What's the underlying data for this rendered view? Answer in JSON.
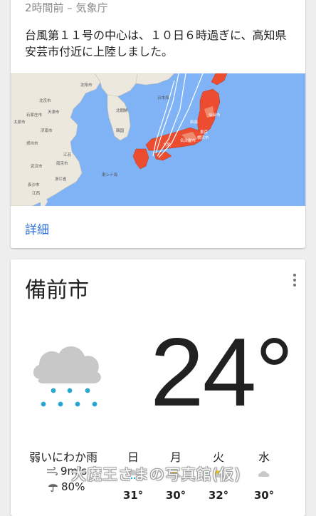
{
  "alert": {
    "meta": "2時間前 – 気象庁",
    "headline": "台風第１１号の中心は、１０日６時過ぎに、高知県安芸市付近に上陸しました。",
    "map_labels": [
      "北京市",
      "天津市",
      "石家庄市",
      "太原市",
      "济南市",
      "郑州市",
      "江苏",
      "南京市",
      "武汉市",
      "長沙市",
      "浙江省",
      "江西",
      "沈阳市",
      "北朝鮮",
      "韓国",
      "日本海",
      "東シナ海",
      "仙台市",
      "新潟",
      "東京",
      "横浜市",
      "名古屋市",
      "大阪"
    ],
    "details_label": "詳細"
  },
  "weather": {
    "city": "備前市",
    "temperature": "24°",
    "condition": "弱いにわか雨",
    "wind": "9m/s",
    "precipitation": "80%",
    "forecast": [
      {
        "day": "日",
        "temp": "31°"
      },
      {
        "day": "月",
        "temp": "30°"
      },
      {
        "day": "火",
        "temp": "32°"
      },
      {
        "day": "水",
        "temp": "30°"
      }
    ]
  },
  "colors": {
    "link": "#2f6fd6",
    "sea": "#7fb3f5",
    "land": "#ece8de",
    "warning_red": "#ec4d31",
    "rain_drop": "#27a8d3",
    "cloud": "#c8c8c8"
  },
  "icons": [
    "more-vert-icon",
    "cloud-rain-icon",
    "wind-icon",
    "umbrella-icon"
  ],
  "watermark": "大魔王さまの写真館(仮)"
}
